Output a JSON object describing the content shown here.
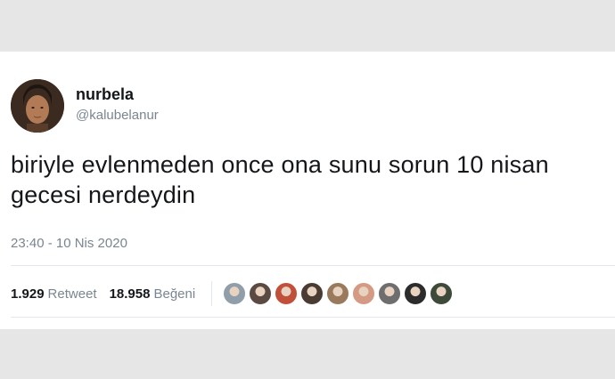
{
  "tweet": {
    "display_name": "nurbela",
    "handle": "@kalubelanur",
    "text": "biriyle evlenmeden once ona sunu sorun 10 nisan gecesi nerdeydin",
    "timestamp": "23:40 - 10 Nis 2020",
    "retweet_count": "1.929",
    "retweet_label": "Retweet",
    "like_count": "18.958",
    "like_label": "Beğeni"
  },
  "likers": [
    {
      "icon": "liker-avatar-1",
      "color": "#8f9ea8"
    },
    {
      "icon": "liker-avatar-2",
      "color": "#5a4a42"
    },
    {
      "icon": "liker-avatar-3",
      "color": "#c0503a"
    },
    {
      "icon": "liker-avatar-4",
      "color": "#4a3b33"
    },
    {
      "icon": "liker-avatar-5",
      "color": "#9a7a5c"
    },
    {
      "icon": "liker-avatar-6",
      "color": "#d49a84"
    },
    {
      "icon": "liker-avatar-7",
      "color": "#6e6e6e"
    },
    {
      "icon": "liker-avatar-8",
      "color": "#2c2c2c"
    },
    {
      "icon": "liker-avatar-9",
      "color": "#3d4a3a"
    }
  ]
}
